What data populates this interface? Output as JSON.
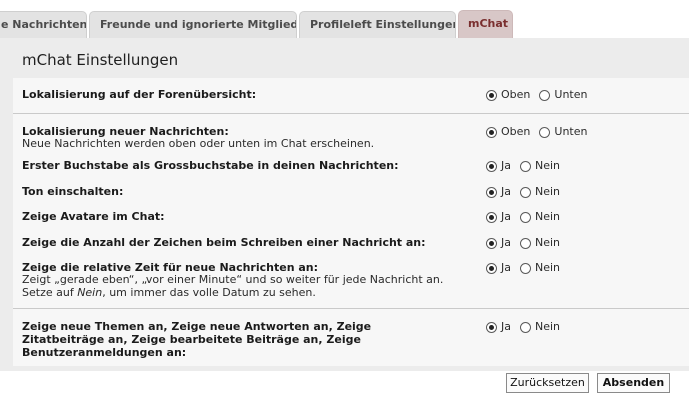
{
  "tabs": [
    {
      "label": "e Nachrichten",
      "active": false
    },
    {
      "label": "Freunde und ignorierte Mitglieder",
      "active": false
    },
    {
      "label": "Profileleft Einstellungen",
      "active": false
    },
    {
      "label": "mChat",
      "active": true
    }
  ],
  "panel": {
    "title": "mChat Einstellungen"
  },
  "settings": [
    {
      "label": "Lokalisierung auf der Forenübersicht:",
      "desc": "",
      "options": [
        "Oben",
        "Unten"
      ],
      "selected": "Oben"
    },
    {
      "label": "Lokalisierung neuer Nachrichten:",
      "desc": "Neue Nachrichten werden oben oder unten im Chat erscheinen.",
      "options": [
        "Oben",
        "Unten"
      ],
      "selected": "Oben"
    },
    {
      "label": "Erster Buchstabe als Grossbuchstabe in deinen Nachrichten:",
      "desc": "",
      "options": [
        "Ja",
        "Nein"
      ],
      "selected": "Ja"
    },
    {
      "label": "Ton einschalten:",
      "desc": "",
      "options": [
        "Ja",
        "Nein"
      ],
      "selected": "Ja"
    },
    {
      "label": "Zeige Avatare im Chat:",
      "desc": "",
      "options": [
        "Ja",
        "Nein"
      ],
      "selected": "Ja"
    },
    {
      "label": "Zeige die Anzahl der Zeichen beim Schreiben einer Nachricht an:",
      "desc": "",
      "options": [
        "Ja",
        "Nein"
      ],
      "selected": "Ja"
    },
    {
      "label": "Zeige die relative Zeit für neue Nachrichten an:",
      "desc_line1": "Zeigt „gerade eben“, „vor einer Minute“ und so weiter für jede Nachricht an.",
      "desc_line2_pre": "Setze auf ",
      "desc_line2_em": "Nein",
      "desc_line2_post": ", um immer das volle Datum zu sehen.",
      "options": [
        "Ja",
        "Nein"
      ],
      "selected": "Ja"
    },
    {
      "label_lines": [
        "Zeige neue Themen an, Zeige neue Antworten an, Zeige",
        "Zitatbeiträge an, Zeige bearbeitete Beiträge an, Zeige",
        "Benutzeranmeldungen an:"
      ],
      "options": [
        "Ja",
        "Nein"
      ],
      "selected": "Ja"
    }
  ],
  "buttons": {
    "reset": "Zurücksetzen",
    "submit": "Absenden"
  }
}
